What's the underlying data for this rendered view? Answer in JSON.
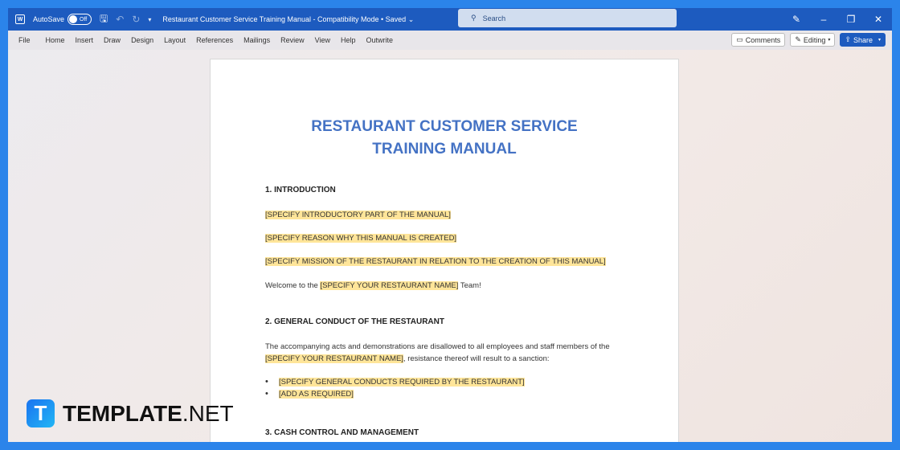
{
  "titlebar": {
    "app_icon": "W",
    "autosave": "AutoSave",
    "toggle": "Off",
    "doc_title": "Restaurant Customer Service Training Manual  -  Compatibility Mode • Saved ⌄",
    "search": "Search"
  },
  "ribbon": {
    "tabs": [
      "File",
      "Home",
      "Insert",
      "Draw",
      "Design",
      "Layout",
      "References",
      "Mailings",
      "Review",
      "View",
      "Help",
      "Outwrite"
    ],
    "comments": "Comments",
    "editing": "Editing",
    "share": "Share"
  },
  "document": {
    "title_line1": "RESTAURANT CUSTOMER SERVICE",
    "title_line2": "TRAINING MANUAL",
    "s1": "1. INTRODUCTION",
    "p1": "[SPECIFY INTRODUCTORY PART OF THE MANUAL]",
    "p2": "[SPECIFY REASON WHY THIS MANUAL IS CREATED]",
    "p3": "[SPECIFY MISSION OF THE RESTAURANT IN RELATION TO THE CREATION OF THIS MANUAL]",
    "welcome_pre": "Welcome to the ",
    "welcome_hl": "[SPECIFY YOUR RESTAURANT NAME]",
    "welcome_post": " Team!",
    "s2": "2. GENERAL CONDUCT OF THE RESTAURANT",
    "conduct_pre": "The accompanying acts and demonstrations are disallowed to all employees and staff members of the ",
    "conduct_hl": "[SPECIFY YOUR RESTAURANT NAME]",
    "conduct_post": ", resistance thereof will result to a sanction:",
    "bullets": [
      "[SPECIFY GENERAL CONDUCTS REQUIRED BY THE RESTAURANT]",
      "[ADD AS REQUIRED]"
    ],
    "s3": "3. CASH CONTROL AND MANAGEMENT"
  },
  "watermark": {
    "icon": "T",
    "bold": "TEMPLATE",
    "light": ".NET"
  }
}
